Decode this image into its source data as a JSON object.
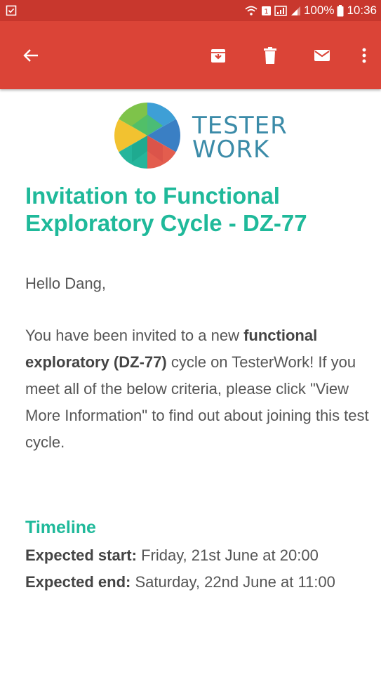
{
  "status_bar": {
    "battery": "100%",
    "time": "10:36",
    "icons": [
      "notification-icon",
      "wifi-icon",
      "sim-icon",
      "data-signal-icon",
      "signal-icon",
      "battery-icon"
    ]
  },
  "app_bar": {
    "icons": [
      "back-arrow-icon",
      "archive-icon",
      "delete-icon",
      "mark-unread-icon",
      "more-options-icon"
    ]
  },
  "logo": {
    "line1": "TESTER",
    "line2": "WORK"
  },
  "email": {
    "title": "Invitation to Functional Exploratory Cycle - DZ-77",
    "greeting": "Hello Dang,",
    "intro_pre": "You have been invited to a new ",
    "intro_bold": "functional exploratory (DZ-77)",
    "intro_post": " cycle on TesterWork! If you meet all of the below criteria, please click \"View More Information\" to find out about joining this test cycle.",
    "timeline_heading": "Timeline",
    "start_label": "Expected start:",
    "start_value": " Friday, 21st June at 20:00",
    "end_label": "Expected end:",
    "end_value": " Saturday, 22nd June at 11:00"
  },
  "colors": {
    "status_bar": "#c8372d",
    "app_bar": "#db4437",
    "accent": "#1fb99a",
    "logo_text": "#3b8ba8"
  }
}
